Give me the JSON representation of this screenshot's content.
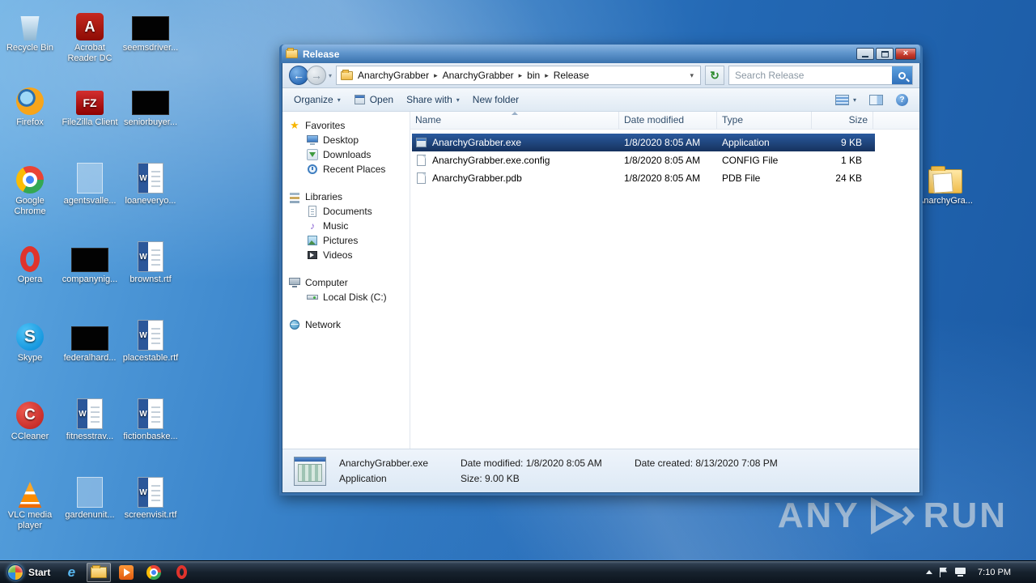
{
  "glyphs": {
    "chevron_down": "▾",
    "crumb_sep": "▸",
    "back": "←",
    "forward": "→",
    "refresh": "↻",
    "close": "×",
    "star": "★",
    "music": "♪"
  },
  "desktop": {
    "icons": [
      {
        "label": "Recycle Bin",
        "icon": "recycle-bin"
      },
      {
        "label": "Firefox",
        "icon": "firefox"
      },
      {
        "label": "Google Chrome",
        "icon": "chrome"
      },
      {
        "label": "Opera",
        "icon": "opera"
      },
      {
        "label": "Skype",
        "icon": "skype"
      },
      {
        "label": "CCleaner",
        "icon": "ccleaner"
      },
      {
        "label": "VLC media player",
        "icon": "vlc"
      },
      {
        "label": "Acrobat Reader DC",
        "icon": "acrobat"
      },
      {
        "label": "FileZilla Client",
        "icon": "filezilla"
      },
      {
        "label": "agentsvalle...",
        "icon": "document-ghost"
      },
      {
        "label": "companynig...",
        "icon": "thumbnail-black"
      },
      {
        "label": "federalhard...",
        "icon": "thumbnail-black"
      },
      {
        "label": "fitnesstrav...",
        "icon": "word-document"
      },
      {
        "label": "gardenunit...",
        "icon": "document-ghost"
      },
      {
        "label": "seemsdriver...",
        "icon": "thumbnail-black"
      },
      {
        "label": "seniorbuyer...",
        "icon": "thumbnail-black"
      },
      {
        "label": "loaneveryo...",
        "icon": "word-document"
      },
      {
        "label": "brownst.rtf",
        "icon": "word-document"
      },
      {
        "label": "placestable.rtf",
        "icon": "word-document"
      },
      {
        "label": "fictionbaske...",
        "icon": "word-document"
      },
      {
        "label": "screenvisit.rtf",
        "icon": "word-document"
      },
      {
        "label": "AnarchyGra...",
        "icon": "folder"
      }
    ]
  },
  "window": {
    "title": "Release",
    "breadcrumb": [
      "AnarchyGrabber",
      "AnarchyGrabber",
      "bin",
      "Release"
    ],
    "search_placeholder": "Search Release",
    "toolbar": {
      "organize": "Organize",
      "open": "Open",
      "share_with": "Share with",
      "new_folder": "New folder"
    },
    "nav": {
      "favorites": {
        "label": "Favorites",
        "items": [
          "Desktop",
          "Downloads",
          "Recent Places"
        ]
      },
      "libraries": {
        "label": "Libraries",
        "items": [
          "Documents",
          "Music",
          "Pictures",
          "Videos"
        ]
      },
      "computer": {
        "label": "Computer",
        "items": [
          "Local Disk (C:)"
        ]
      },
      "network": {
        "label": "Network"
      }
    },
    "columns": [
      "Name",
      "Date modified",
      "Type",
      "Size"
    ],
    "files": [
      {
        "name": "AnarchyGrabber.exe",
        "modified": "1/8/2020 8:05 AM",
        "type": "Application",
        "size": "9 KB",
        "selected": true
      },
      {
        "name": "AnarchyGrabber.exe.config",
        "modified": "1/8/2020 8:05 AM",
        "type": "CONFIG File",
        "size": "1 KB",
        "selected": false
      },
      {
        "name": "AnarchyGrabber.pdb",
        "modified": "1/8/2020 8:05 AM",
        "type": "PDB File",
        "size": "24 KB",
        "selected": false
      }
    ],
    "details": {
      "name": "AnarchyGrabber.exe",
      "modified": "Date modified: 1/8/2020 8:05 AM",
      "created": "Date created: 8/13/2020 7:08 PM",
      "type": "Application",
      "size": "Size: 9.00 KB"
    }
  },
  "taskbar": {
    "start_label": "Start",
    "clock": "7:10 PM"
  },
  "watermark": {
    "any": "ANY",
    "run": "RUN"
  },
  "colors": {
    "selection": "#1b3f76",
    "titlebar": "#5f95cc",
    "taskbar": "#17222e",
    "wallpaper": "#2368b4"
  }
}
